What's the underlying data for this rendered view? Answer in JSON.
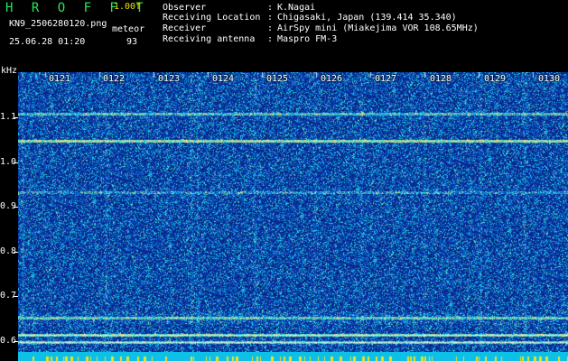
{
  "header": {
    "title": "H R O F F T",
    "version": "1.00f",
    "filename": "KN9_2506280120.png",
    "datetime": "25.06.28 01:20",
    "meteor_label": "meteor",
    "meteor_count": "93"
  },
  "info": [
    {
      "label": "Observer",
      "value": "K.Nagai"
    },
    {
      "label": "Receiving Location",
      "value": "Chigasaki, Japan (139.414 35.340)"
    },
    {
      "label": "Receiver",
      "value": "AirSpy mini (Miakejima VOR 108.65MHz)"
    },
    {
      "label": "Receiving antenna",
      "value": "Maspro FM-3"
    }
  ],
  "info_separator": ":",
  "y_axis": {
    "unit": "kHz",
    "ticks": [
      "1.1",
      "1.0",
      "0.9",
      "0.8",
      "0.7",
      "0.6"
    ]
  },
  "time_labels": [
    "0121",
    "0122",
    "0123",
    "0124",
    "0125",
    "0126",
    "0127",
    "0128",
    "0129",
    "0130"
  ],
  "colors": {
    "background": "#000000",
    "title_green": "#22e85a",
    "version_yellow": "#e6e600",
    "spectrum_base": "#0a2a8a",
    "bottom_strip_cyan": "#0cc0e8"
  }
}
